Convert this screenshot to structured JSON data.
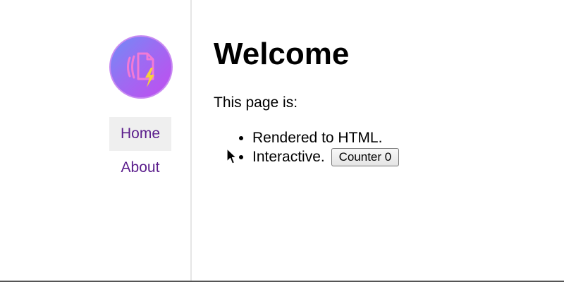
{
  "sidebar": {
    "logo_icon": "document-lightning-icon",
    "nav": [
      {
        "label": "Home",
        "active": true
      },
      {
        "label": "About",
        "active": false
      }
    ]
  },
  "main": {
    "title": "Welcome",
    "intro": "This page is:",
    "items": [
      {
        "text": "Rendered to HTML."
      },
      {
        "text": "Interactive.",
        "button_label": "Counter 0"
      }
    ]
  },
  "colors": {
    "nav_link": "#5b1e8c",
    "nav_active_bg": "#efefef",
    "logo_gradient_start": "#6f8cf7",
    "logo_gradient_end": "#c24cf0"
  }
}
